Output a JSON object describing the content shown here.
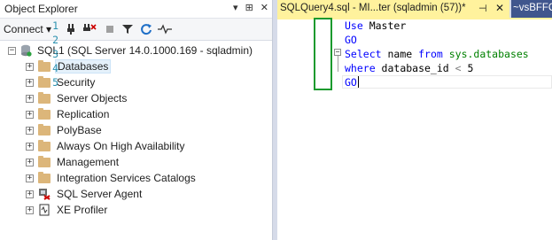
{
  "object_explorer": {
    "title": "Object Explorer",
    "title_buttons": [
      "▾",
      "⊞",
      "✕"
    ],
    "toolbar": {
      "connect_label": "Connect ▾"
    },
    "server": {
      "label": "SQL1 (SQL Server 14.0.1000.169 - sqladmin)"
    },
    "nodes": [
      {
        "label": "Databases",
        "type": "folder"
      },
      {
        "label": "Security",
        "type": "folder"
      },
      {
        "label": "Server Objects",
        "type": "folder"
      },
      {
        "label": "Replication",
        "type": "folder"
      },
      {
        "label": "PolyBase",
        "type": "folder"
      },
      {
        "label": "Always On High Availability",
        "type": "folder"
      },
      {
        "label": "Management",
        "type": "folder"
      },
      {
        "label": "Integration Services Catalogs",
        "type": "folder"
      },
      {
        "label": "SQL Server Agent",
        "type": "agent"
      },
      {
        "label": "XE Profiler",
        "type": "profiler"
      }
    ]
  },
  "editor": {
    "tabs": [
      {
        "label": "SQLQuery4.sql - MI...ter (sqladmin (57))*",
        "active": true
      },
      {
        "label": "~vsBFFC",
        "active": false
      }
    ],
    "line_numbers": [
      "1",
      "2",
      "3",
      "4",
      "5"
    ],
    "lines": [
      [
        {
          "t": "Use ",
          "c": "kw"
        },
        {
          "t": "Master",
          "c": "tx"
        }
      ],
      [
        {
          "t": "GO",
          "c": "kw"
        }
      ],
      [
        {
          "t": "Select ",
          "c": "kw"
        },
        {
          "t": "name ",
          "c": "tx"
        },
        {
          "t": "from ",
          "c": "kw"
        },
        {
          "t": "sys.databases",
          "c": "sys"
        }
      ],
      [
        {
          "t": "where ",
          "c": "kw"
        },
        {
          "t": "database_id ",
          "c": "tx"
        },
        {
          "t": "< ",
          "c": "op"
        },
        {
          "t": "5",
          "c": "tx"
        }
      ],
      [
        {
          "t": "GO",
          "c": "kw"
        }
      ]
    ]
  },
  "colors": {
    "active_tab": "#fff29d",
    "inactive_tab": "#40568d",
    "highlight_box": "#1a9a2e"
  }
}
